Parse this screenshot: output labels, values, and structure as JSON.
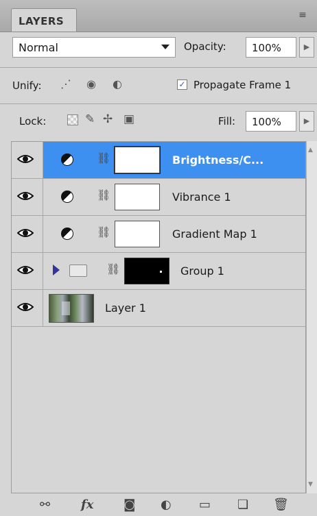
{
  "panel": {
    "tab": "LAYERS",
    "menu_icon": "≡"
  },
  "blend": {
    "mode": "Normal",
    "opacity_label": "Opacity:",
    "opacity": "100%"
  },
  "unify": {
    "label": "Unify:",
    "propagate_label": "Propagate Frame 1",
    "propagate_checked": true
  },
  "lock": {
    "label": "Lock:",
    "fill_label": "Fill:",
    "fill": "100%"
  },
  "layers": [
    {
      "name": "Brightness/C...",
      "selected": true,
      "kind": "adjustment"
    },
    {
      "name": "Vibrance 1",
      "selected": false,
      "kind": "adjustment"
    },
    {
      "name": "Gradient Map 1",
      "selected": false,
      "kind": "adjustment"
    },
    {
      "name": "Group 1",
      "selected": false,
      "kind": "group"
    },
    {
      "name": "Layer 1",
      "selected": false,
      "kind": "pixel"
    }
  ],
  "toolbar_icons": [
    "link-icon",
    "fx-icon",
    "add-mask-icon",
    "adjustment-icon",
    "new-group-icon",
    "new-layer-icon",
    "trash-icon"
  ],
  "toolbar": {
    "fx": "fx"
  },
  "colors": {
    "selection": "#3d8ff0",
    "panel_bg": "#d6d6d6"
  }
}
